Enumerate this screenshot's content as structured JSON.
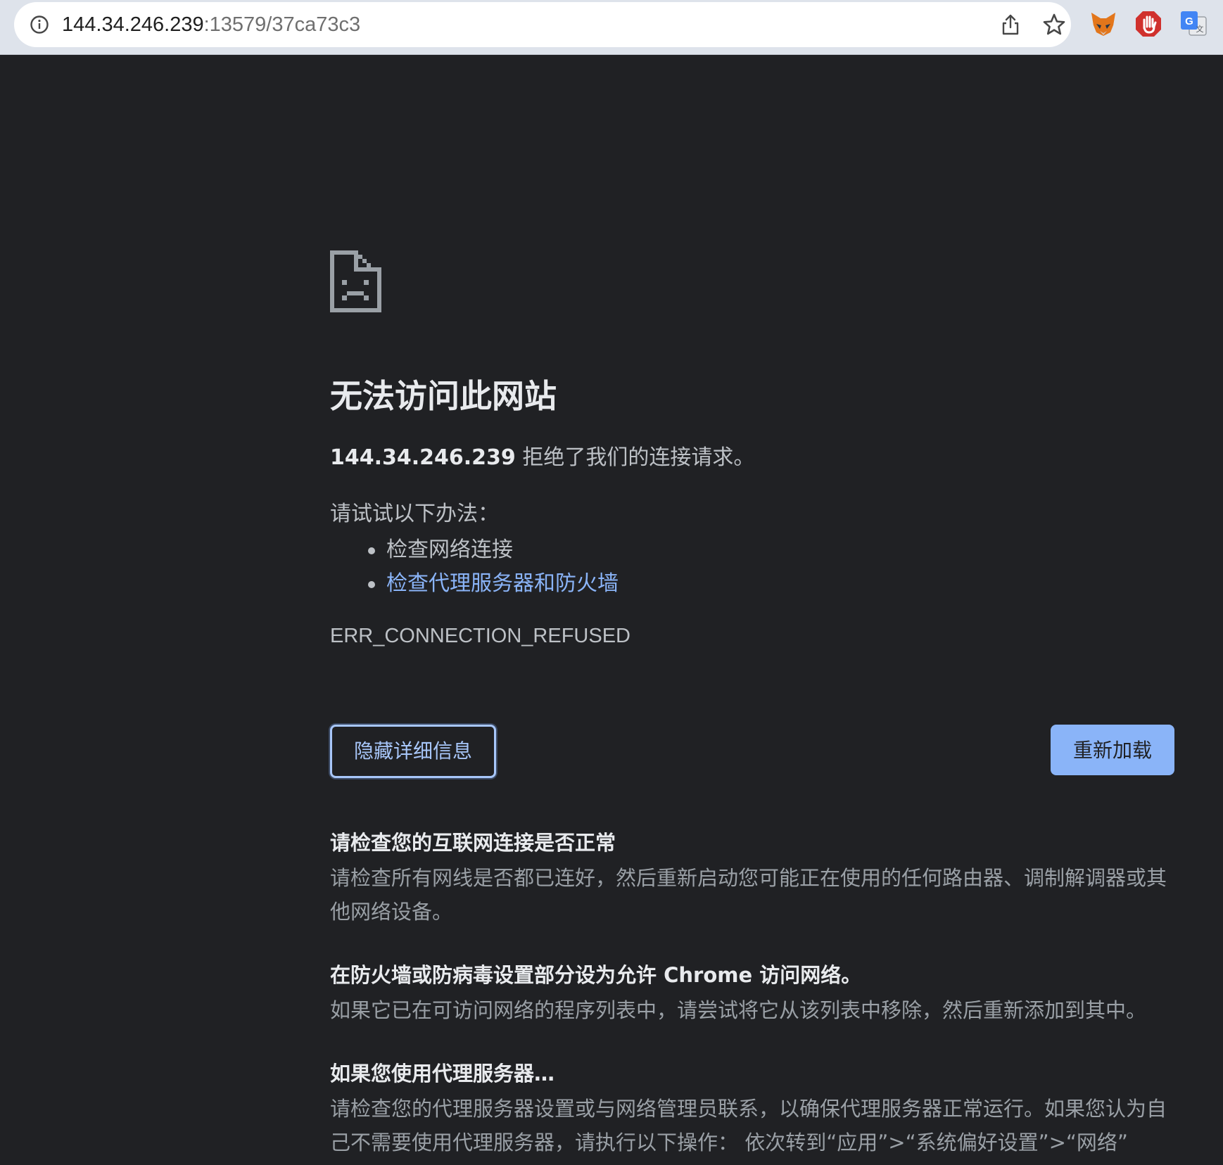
{
  "browser": {
    "url_host": "144.34.246.239",
    "url_path": ":13579/37ca73c3",
    "icons": {
      "site_info": "info-icon",
      "share": "share-icon",
      "bookmark": "star-icon",
      "extensions": [
        "metamask-fox-icon",
        "adblock-stop-hand-icon",
        "google-translate-icon"
      ]
    },
    "colors": {
      "toolbar_bg": "#dee3eb",
      "page_bg": "#202124",
      "link": "#8ab4f8",
      "primary_button": "#8ab4f8"
    }
  },
  "error": {
    "icon": "sad-document-icon",
    "headline": "无法访问此网站",
    "summary_host": "144.34.246.239",
    "summary_text": " 拒绝了我们的连接请求。",
    "try_label": "请试试以下办法：",
    "suggestions": [
      {
        "label": "检查网络连接",
        "is_link": false
      },
      {
        "label": "检查代理服务器和防火墙",
        "is_link": true
      }
    ],
    "code": "ERR_CONNECTION_REFUSED",
    "details_button": "隐藏详细信息",
    "reload_button": "重新加载",
    "details": [
      {
        "title": "请检查您的互联网连接是否正常",
        "body": "请检查所有网线是否都已连好，然后重新启动您可能正在使用的任何路由器、调制解调器或其他网络设备。"
      },
      {
        "title": "在防火墙或防病毒设置部分设为允许 Chrome 访问网络。",
        "body": "如果它已在可访问网络的程序列表中，请尝试将它从该列表中移除，然后重新添加到其中。"
      },
      {
        "title": "如果您使用代理服务器…",
        "body": "请检查您的代理服务器设置或与网络管理员联系，以确保代理服务器正常运行。如果您认为自己不需要使用代理服务器，请执行以下操作： 依次转到“应用”>“系统偏好设置”>“网络”"
      }
    ]
  }
}
